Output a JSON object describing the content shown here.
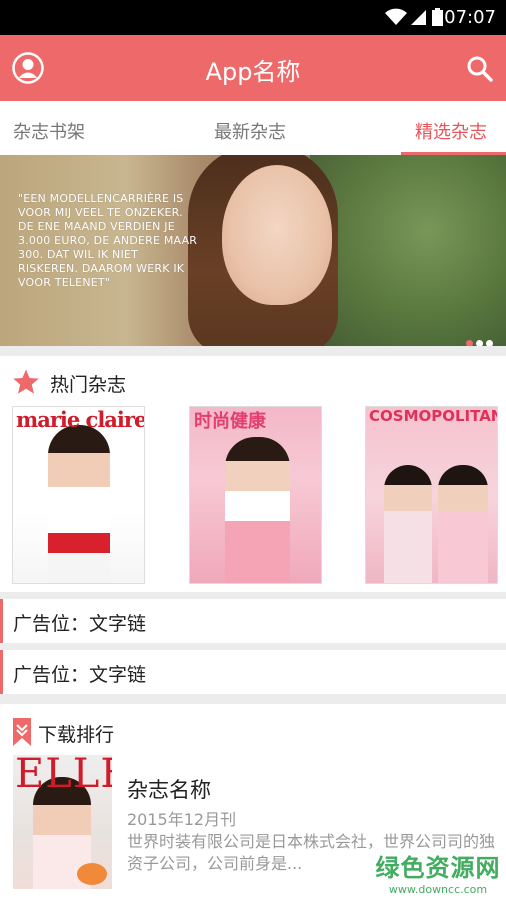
{
  "status_bar": {
    "time": "07:07"
  },
  "app_bar": {
    "title": "App名称"
  },
  "tabs": [
    {
      "label": "杂志书架"
    },
    {
      "label": "最新杂志"
    },
    {
      "label": "精选杂志",
      "active": true
    }
  ],
  "banner": {
    "quote": "\"EEN MODELLENCARRIÈRE IS VOOR MIJ VEEL TE ONZEKER. DE ENE MAAND VERDIEN JE 3.000 EURO, DE ANDERE MAAR 300. DAT WIL IK NIET RISKEREN. DAAROM WERK IK VOOR TELENET\"",
    "page_count": 3,
    "active_page": 1
  },
  "hot_section": {
    "title": "热门杂志",
    "covers": [
      {
        "masthead": "marie claire"
      },
      {
        "masthead": "时尚健康"
      },
      {
        "masthead": "COSMOPOLITAN"
      }
    ]
  },
  "ads": [
    {
      "text": "广告位：文字链"
    },
    {
      "text": "广告位：文字链"
    }
  ],
  "download_section": {
    "title": "下载排行",
    "items": [
      {
        "cover_masthead": "ELLE",
        "name": "杂志名称",
        "date": "2015年12月刊",
        "desc": "世界时装有限公司是日本株式会社，世界公司司的独资子公司，公司前身是..."
      }
    ]
  },
  "watermark": {
    "line1": "绿色资源网",
    "line2": "www.downcc.com"
  },
  "colors": {
    "accent": "#ee6a6a",
    "tab_active": "#e9545a"
  }
}
